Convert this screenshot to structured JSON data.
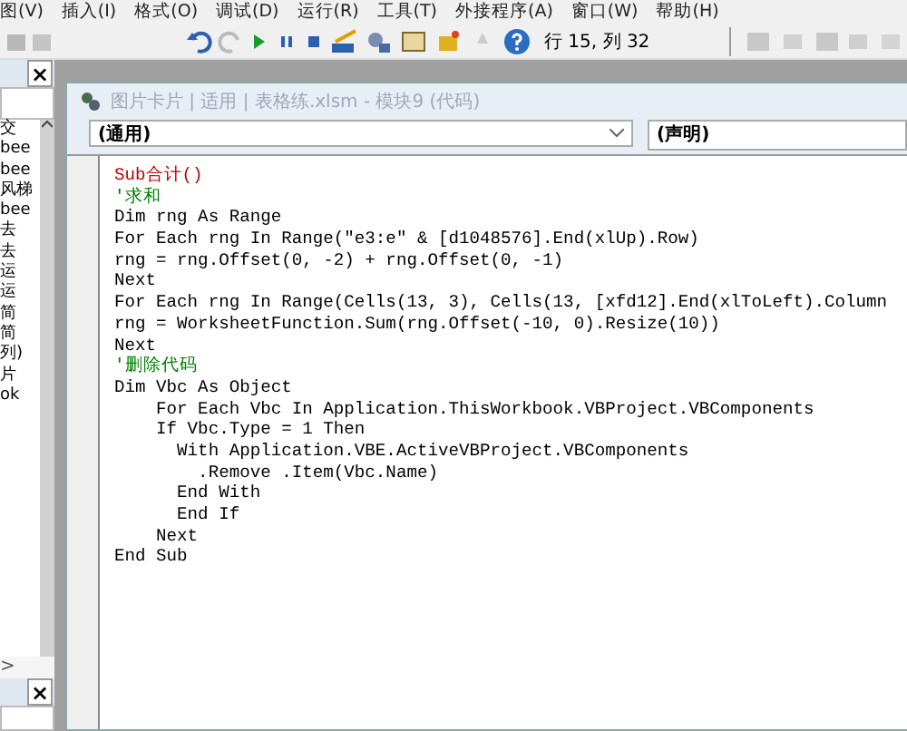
{
  "menu": [
    "图(V)",
    "插入(I)",
    "格式(O)",
    "调试(D)",
    "运行(R)",
    "工具(T)",
    "外接程序(A)",
    "窗口(W)",
    "帮助(H)"
  ],
  "toolbar": {
    "position": "行 15, 列 32"
  },
  "project_panel": {
    "close": "×",
    "items": [
      "交",
      "bee",
      "bee",
      "风梯",
      "bee",
      "去",
      "去",
      "运",
      "运",
      "简",
      "简",
      "列)",
      "片",
      "ok"
    ],
    "expand": ">",
    "close_2": "×"
  },
  "code_window": {
    "title": "图片卡片 | 适用 | 表格练.xlsm - 模块9 (代码)",
    "object_dropdown": "(通用)",
    "procedure_dropdown": "(声明)",
    "lines": [
      {
        "text": "Sub合计()",
        "kind": "error"
      },
      {
        "text": "'求和",
        "kind": "comment"
      },
      {
        "text": "Dim rng As Range",
        "kind": "code"
      },
      {
        "text": "For Each rng In Range(\"e3:e\" & [d1048576].End(xlUp).Row)",
        "kind": "code"
      },
      {
        "text": "rng = rng.Offset(0, -2) + rng.Offset(0, -1)",
        "kind": "code"
      },
      {
        "text": "Next",
        "kind": "code"
      },
      {
        "text": "For Each rng In Range(Cells(13, 3), Cells(13, [xfd12].End(xlToLeft).Column",
        "kind": "code"
      },
      {
        "text": "rng = WorksheetFunction.Sum(rng.Offset(-10, 0).Resize(10))",
        "kind": "code"
      },
      {
        "text": "Next",
        "kind": "code"
      },
      {
        "text": "'删除代码",
        "kind": "comment"
      },
      {
        "text": "Dim Vbc As Object",
        "kind": "code"
      },
      {
        "text": "    For Each Vbc In Application.ThisWorkbook.VBProject.VBComponents",
        "kind": "code"
      },
      {
        "text": "    If Vbc.Type = 1 Then",
        "kind": "code"
      },
      {
        "text": "      With Application.VBE.ActiveVBProject.VBComponents",
        "kind": "code"
      },
      {
        "text": "        .Remove .Item(Vbc.Name)",
        "kind": "code"
      },
      {
        "text": "      End With",
        "kind": "code"
      },
      {
        "text": "      End If",
        "kind": "code"
      },
      {
        "text": "    Next",
        "kind": "code"
      },
      {
        "text": "End Sub",
        "kind": "code"
      }
    ]
  }
}
